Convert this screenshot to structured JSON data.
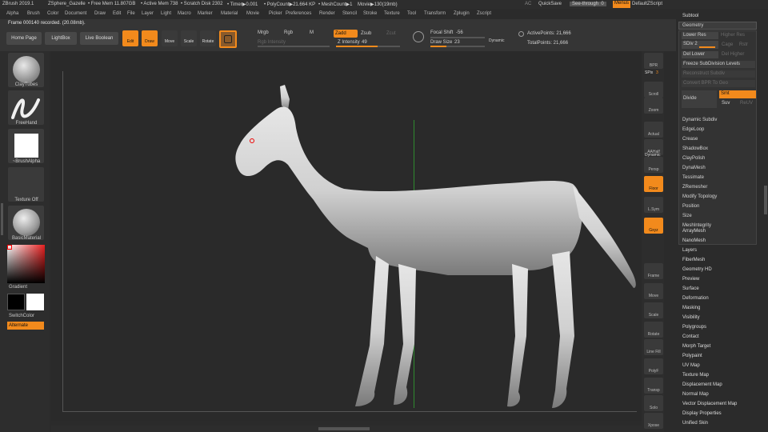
{
  "titlebar": {
    "app": "ZBrush 2019.1",
    "doc": "ZSphere_Gazelle",
    "free_mem": "• Free Mem 11.807GB",
    "active_mem": "• Active Mem 738",
    "scratch": "• Scratch Disk 2302",
    "timer": "• Timer▶0.001",
    "polycount": "• PolyCount▶21.664 KP",
    "meshcount": "• MeshCount▶1",
    "movie": "Movie▶130(19mb)",
    "ac": "AC",
    "quicksave": "QuickSave",
    "seethrough": "See-through",
    "seethrough_val": "0",
    "menus": "Menus",
    "script": "DefaultZScript"
  },
  "menu": [
    "Alpha",
    "Brush",
    "Color",
    "Document",
    "Draw",
    "Edit",
    "File",
    "Layer",
    "Light",
    "Macro",
    "Marker",
    "Material",
    "Movie",
    "Picker",
    "Preferences",
    "Render",
    "Stencil",
    "Stroke",
    "Texture",
    "Tool",
    "Transform",
    "Zplugin",
    "Zscript"
  ],
  "toolbar": {
    "status": "Frame 000140 recorded. (20.08mb).",
    "home": "Home Page",
    "lightbox": "LightBox",
    "liveboolean": "Live Boolean",
    "edit": "Edit",
    "draw": "Draw",
    "move": "Move",
    "scale": "Scale",
    "rotate": "Rotate",
    "mrgb": "Mrgb",
    "rgb": "Rgb",
    "m": "M",
    "rgb_intensity": "Rgb Intensity",
    "zadd": "Zadd",
    "zsub": "Zsub",
    "zcut": "Zcut",
    "z_intensity": "Z Intensity",
    "z_intensity_val": "49",
    "focal_shift": "Focal Shift",
    "focal_shift_val": "-56",
    "draw_size": "Draw Size",
    "draw_size_val": "23",
    "dynamic": "Dynamic",
    "active_points": "ActivePoints: 21,666",
    "total_points": "TotalPoints: 21,666"
  },
  "left": {
    "brush": "ClayTubes",
    "stroke": "FreeHand",
    "alpha": "~BrushAlpha",
    "texture": "Texture Off",
    "material": "BasicMaterial",
    "gradient": "Gradient",
    "switchcolor": "SwitchColor",
    "alternate": "Alternate"
  },
  "shelf": [
    "BPR",
    "SPix",
    "3",
    "Scroll",
    "Zoom",
    "Actual",
    "AAHalf",
    "Dynamic",
    "Persp",
    "Floor",
    "L.Sym",
    "Gxyz",
    "Frame",
    "Move",
    "Scale",
    "Rotate",
    "Line Fill",
    "PolyF",
    "Transp",
    "Solo",
    "Xpose"
  ],
  "palette": {
    "subtool": "Subtool",
    "geometry": "Geometry",
    "lower_res": "Lower Res",
    "higher_res": "Higher Res",
    "sdiv": "SDiv",
    "sdiv_val": "2",
    "cage": "Cage",
    "rstr": "Rstr",
    "del_lower": "Del Lower",
    "del_higher": "Del Higher",
    "freeze": "Freeze SubDivision Levels",
    "reconstruct": "Reconstruct Subdiv",
    "convert": "Convert BPR To Geo",
    "divide": "Divide",
    "smt": "Smt",
    "suv": "Suv",
    "reuv": "ReUV",
    "items": [
      "Dynamic Subdiv",
      "EdgeLoop",
      "Crease",
      "ShadowBox",
      "ClayPolish",
      "DynaMesh",
      "Tessimate",
      "ZRemesher",
      "Modify Topology",
      "Position",
      "Size",
      "MeshIntegrity"
    ],
    "list": [
      "ArrayMesh",
      "NanoMesh",
      "Layers",
      "FiberMesh",
      "Geometry HD",
      "Preview",
      "Surface",
      "Deformation",
      "Masking",
      "Visibility",
      "Polygroups",
      "Contact",
      "Morph Target",
      "Polypaint",
      "UV Map",
      "Texture Map",
      "Displacement Map",
      "Normal Map",
      "Vector Displacement Map",
      "Display Properties",
      "Unified Skin"
    ]
  },
  "colors": {
    "accent": "#f28a1c",
    "bg": "#2b2b2b",
    "panel": "#353535",
    "mesh": "#d8d8d8"
  }
}
